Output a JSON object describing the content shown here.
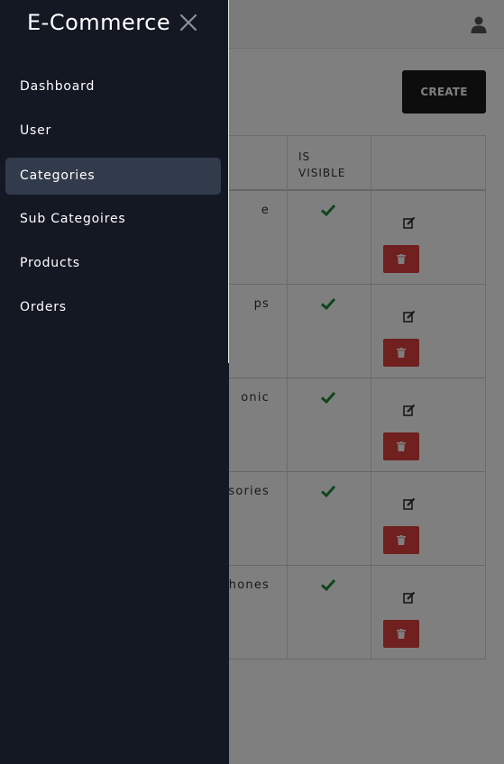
{
  "brand": "E-Commerce",
  "nav": {
    "items": [
      {
        "label": "Dashboard",
        "active": false
      },
      {
        "label": "User",
        "active": false
      },
      {
        "label": "Categories",
        "active": true
      },
      {
        "label": "Sub Categoires",
        "active": false
      },
      {
        "label": "Products",
        "active": false
      },
      {
        "label": "Orders",
        "active": false
      }
    ]
  },
  "toolbar": {
    "create_label": "CREATE"
  },
  "table": {
    "headers": {
      "name": "",
      "visible_line1": "IS",
      "visible_line2": "VISIBLE",
      "actions": ""
    },
    "rows": [
      {
        "name": "e",
        "visible": true
      },
      {
        "name": "ps",
        "visible": true
      },
      {
        "name": "onic",
        "visible": true
      },
      {
        "name": "sories",
        "visible": true
      },
      {
        "name": "phones",
        "visible": true
      }
    ]
  },
  "icons": {
    "close": "close-icon",
    "user": "user-icon",
    "check": "check-icon",
    "edit": "edit-icon",
    "trash": "trash-icon"
  },
  "colors": {
    "drawer_bg": "#141823",
    "active_item_bg": "#323b4b",
    "delete_red": "#e0403f",
    "check_green": "#1f8a3b",
    "create_bg": "#1a1a1a"
  }
}
